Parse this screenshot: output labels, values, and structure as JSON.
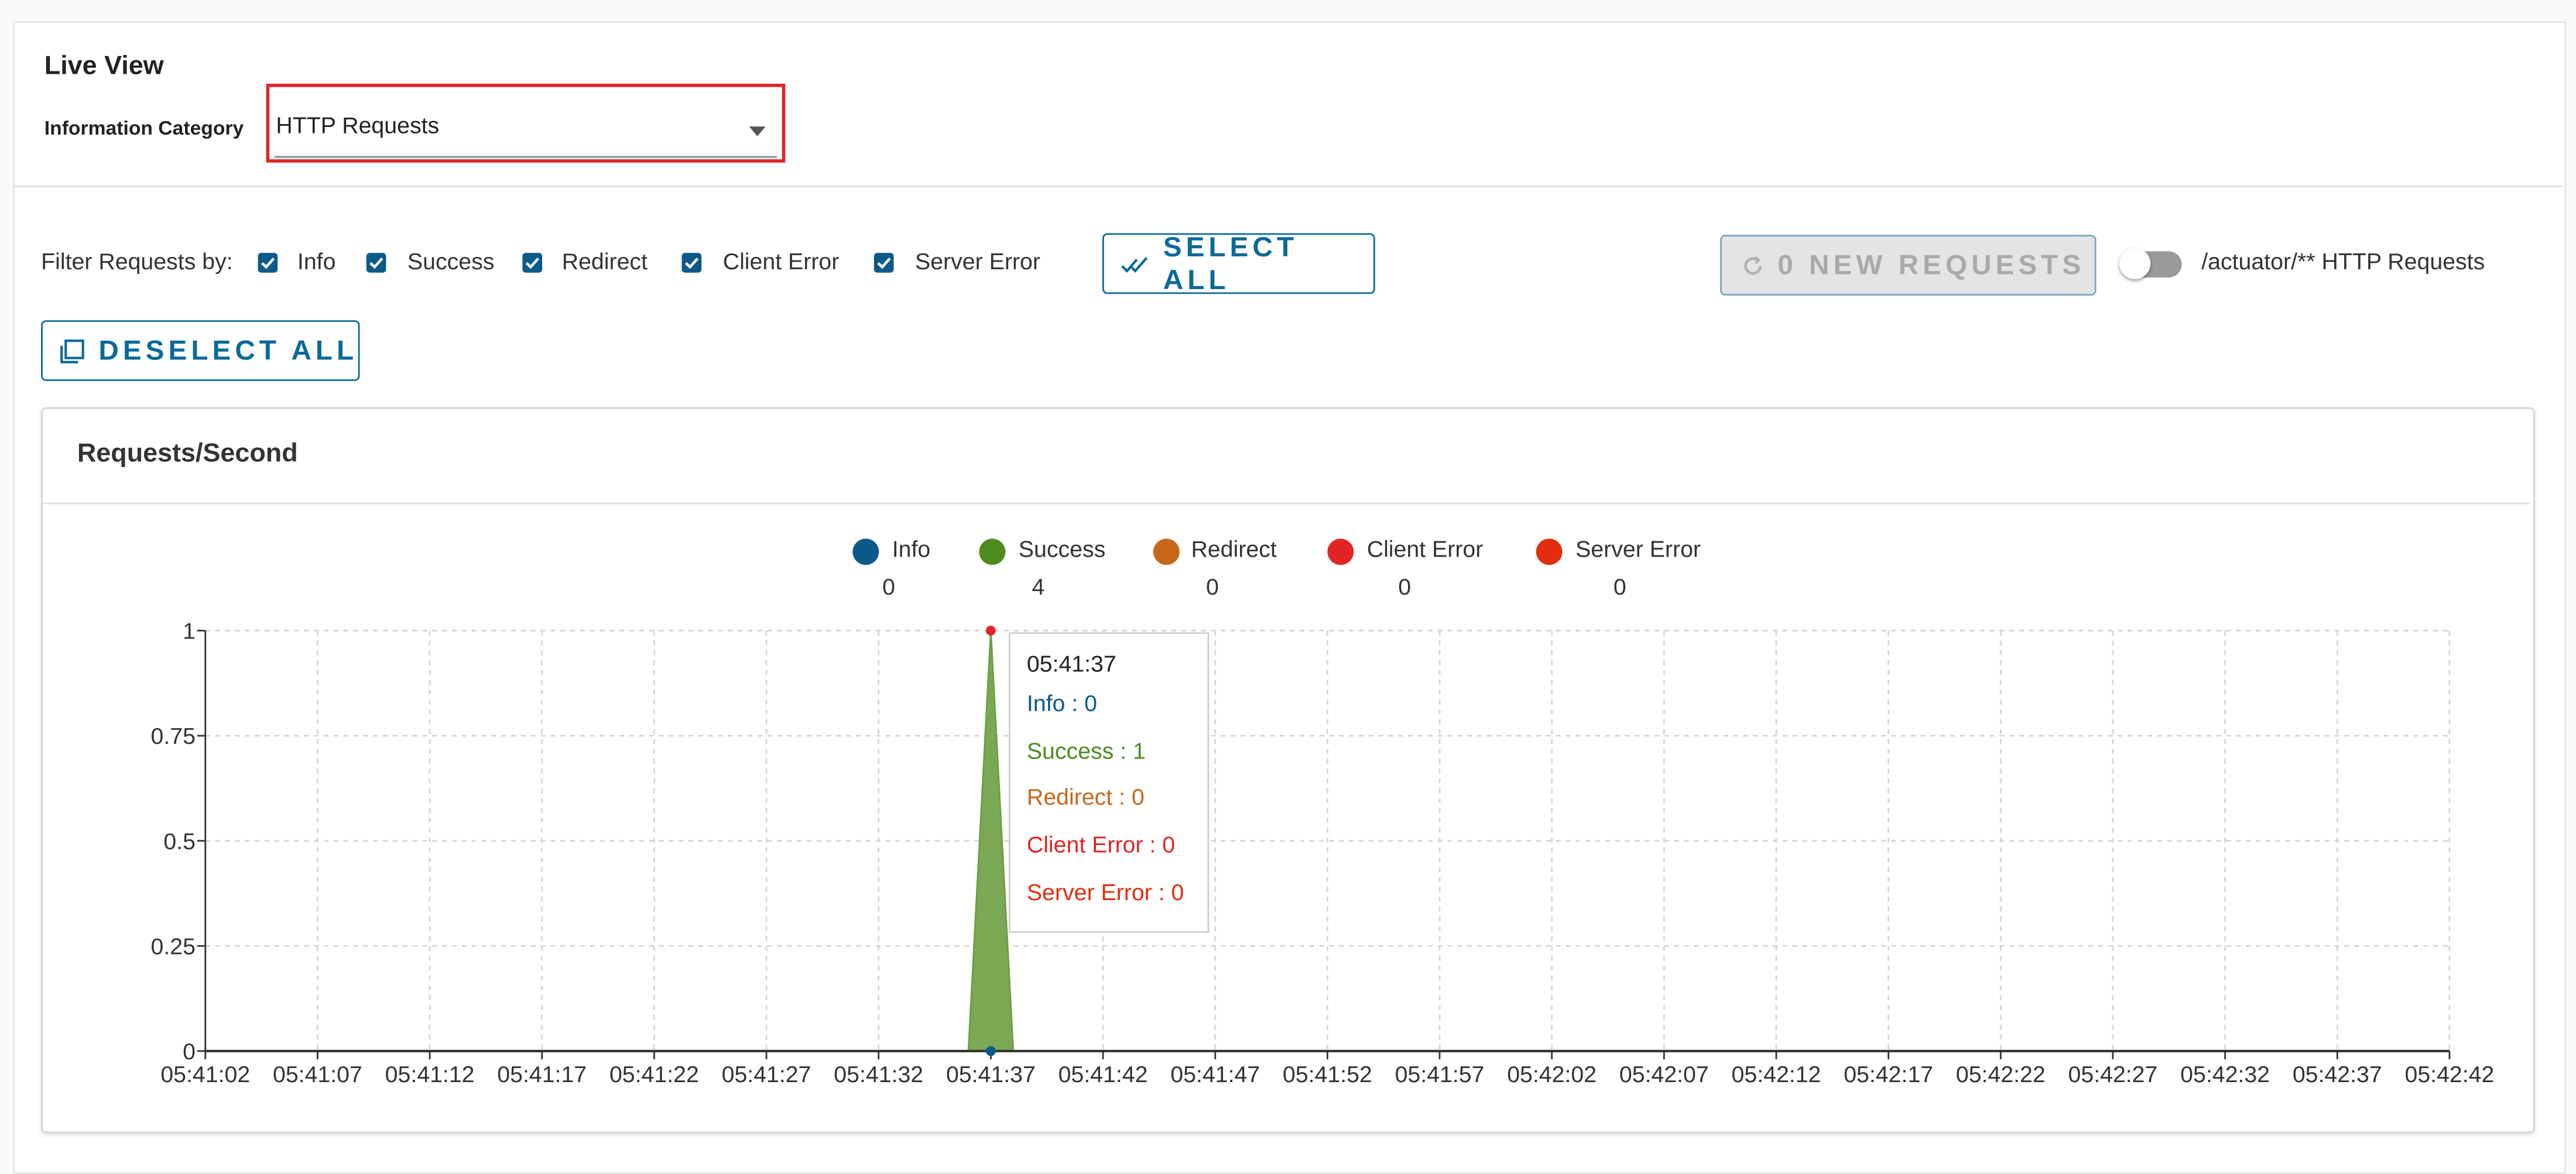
{
  "panel": {
    "title": "Live View",
    "category_label": "Information Category",
    "category_value": "HTTP Requests"
  },
  "filters": {
    "label": "Filter Requests by:",
    "items": [
      {
        "label": "Info",
        "checked": true
      },
      {
        "label": "Success",
        "checked": true
      },
      {
        "label": "Redirect",
        "checked": true
      },
      {
        "label": "Client Error",
        "checked": true
      },
      {
        "label": "Server Error",
        "checked": true
      }
    ],
    "select_all": "SELECT ALL",
    "deselect_all": "DESELECT ALL",
    "new_requests": "0 NEW REQUESTS",
    "toggle_label": "/actuator/** HTTP Requests",
    "toggle_on": false
  },
  "card": {
    "title": "Requests/Second"
  },
  "legend": [
    {
      "name": "Info",
      "count": "0",
      "color": "#0b5a8a"
    },
    {
      "name": "Success",
      "count": "4",
      "color": "#4c8c1e"
    },
    {
      "name": "Redirect",
      "count": "0",
      "color": "#c8671a"
    },
    {
      "name": "Client Error",
      "count": "0",
      "color": "#e12525"
    },
    {
      "name": "Server Error",
      "count": "0",
      "color": "#e12e0e"
    }
  ],
  "tooltip": {
    "time": "05:41:37",
    "lines": [
      "Info : 0",
      "Success : 1",
      "Redirect : 0",
      "Client Error : 0",
      "Server Error : 0"
    ]
  },
  "icons": {
    "select_all": "double-check-icon",
    "deselect_all": "copy-icon",
    "new_requests": "refresh-icon",
    "category": "chevron-down-icon"
  },
  "chart_data": {
    "type": "area",
    "title": "Requests/Second",
    "x": [
      "05:41:02",
      "05:41:07",
      "05:41:12",
      "05:41:17",
      "05:41:22",
      "05:41:27",
      "05:41:32",
      "05:41:37",
      "05:41:42",
      "05:41:47",
      "05:41:52",
      "05:41:57",
      "05:42:02",
      "05:42:07",
      "05:42:12",
      "05:42:17",
      "05:42:22",
      "05:42:27",
      "05:42:32",
      "05:42:37",
      "05:42:42"
    ],
    "y_ticks": [
      "0",
      "0.25",
      "0.5",
      "0.75",
      "1"
    ],
    "ylim": [
      0,
      1
    ],
    "grid": true,
    "series": [
      {
        "name": "Info",
        "color": "#0b5a8a",
        "points": [
          [
            "05:41:37",
            0
          ]
        ]
      },
      {
        "name": "Success",
        "color": "#4c8c1e",
        "points": [
          [
            "05:41:36",
            0
          ],
          [
            "05:41:37",
            1
          ],
          [
            "05:41:38",
            0
          ]
        ]
      },
      {
        "name": "Redirect",
        "color": "#c8671a",
        "points": [
          [
            "05:41:37",
            0
          ]
        ]
      },
      {
        "name": "Client Error",
        "color": "#e12525",
        "points": [
          [
            "05:41:37",
            0
          ]
        ]
      },
      {
        "name": "Server Error",
        "color": "#e12e0e",
        "points": [
          [
            "05:41:37",
            0
          ]
        ]
      }
    ]
  }
}
